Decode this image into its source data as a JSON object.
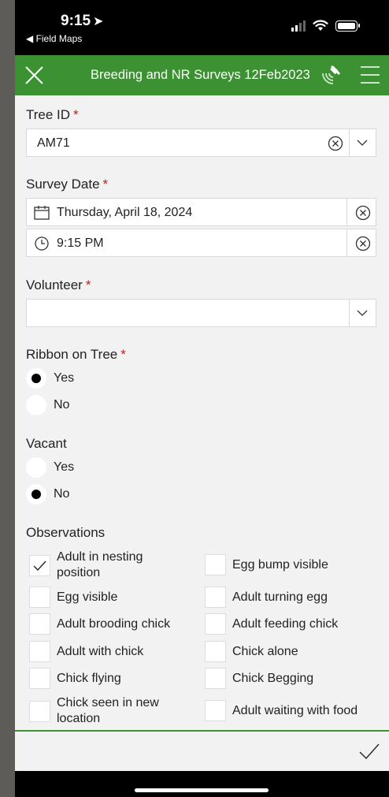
{
  "status_bar": {
    "time": "9:15",
    "back_app": "◀ Field Maps"
  },
  "header": {
    "title": "Breeding and NR Surveys 12Feb2023",
    "close_icon": "close-icon",
    "gps_icon": "gps-satellite-icon",
    "menu_icon": "hamburger-menu-icon"
  },
  "required_marker": "*",
  "tree_id": {
    "label": "Tree ID",
    "value": "AM71"
  },
  "survey_date": {
    "label": "Survey Date",
    "date": "Thursday, April 18, 2024",
    "time": "9:15 PM"
  },
  "volunteer": {
    "label": "Volunteer",
    "value": ""
  },
  "ribbon": {
    "label": "Ribbon on Tree",
    "options": [
      "Yes",
      "No"
    ],
    "selected": "Yes"
  },
  "vacant": {
    "label": "Vacant",
    "options": [
      "Yes",
      "No"
    ],
    "selected": "No"
  },
  "observations": {
    "label": "Observations",
    "items": [
      {
        "label": "Adult in nesting position",
        "checked": true
      },
      {
        "label": "Egg bump visible",
        "checked": false
      },
      {
        "label": "Egg visible",
        "checked": false
      },
      {
        "label": "Adult turning egg",
        "checked": false
      },
      {
        "label": "Adult brooding chick",
        "checked": false
      },
      {
        "label": "Adult feeding chick",
        "checked": false
      },
      {
        "label": "Adult with chick",
        "checked": false
      },
      {
        "label": "Chick alone",
        "checked": false
      },
      {
        "label": "Chick flying",
        "checked": false
      },
      {
        "label": "Chick Begging",
        "checked": false
      },
      {
        "label": "Chick seen in new location",
        "checked": false
      },
      {
        "label": "Adult waiting with food",
        "checked": false
      }
    ]
  },
  "colors": {
    "header_green": "#3c9133",
    "required_red": "#b3261e"
  }
}
